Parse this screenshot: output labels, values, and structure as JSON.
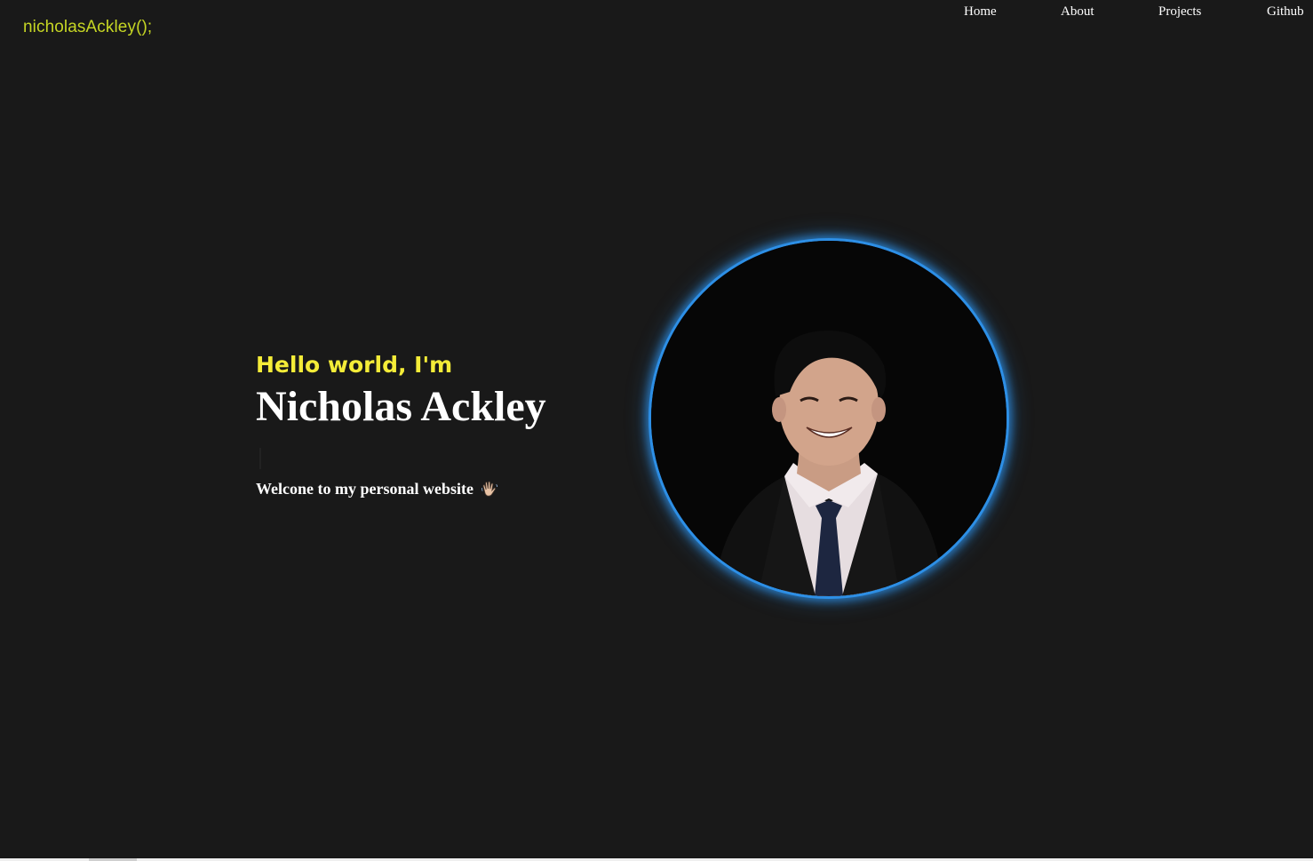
{
  "header": {
    "logo_text": "nicholasAckley();",
    "nav": [
      {
        "label": "Home"
      },
      {
        "label": "About"
      },
      {
        "label": "Projects"
      },
      {
        "label": "Github"
      }
    ]
  },
  "hero": {
    "greeting": "Hello world, I'm",
    "name": "Nicholas Ackley",
    "welcome": "Welcone to my personal website",
    "welcome_icon": "waving-hand-icon",
    "avatar_icon": "profile-photo"
  },
  "colors": {
    "background": "#191919",
    "logo": "#c6d624",
    "greeting": "#f4ec38",
    "text": "#ffffff",
    "avatar_ring": "#2d8fe6"
  }
}
